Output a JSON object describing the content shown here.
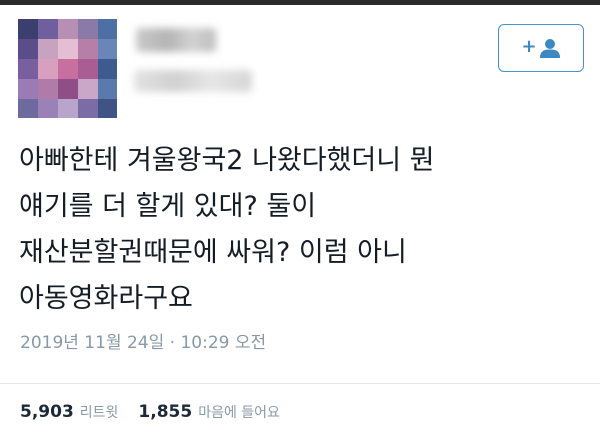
{
  "tweet": {
    "lines": [
      "아빠한테 겨울왕국2 나왔다했더니 뭔",
      "얘기를 더 할게 있대? 둘이",
      "재산분할권때문에 싸워? 이럼 아니",
      "아동영화라구요"
    ],
    "timestamp": "2019년 11월 24일 · 10:29 오전"
  },
  "follow_button": {
    "plus": "+",
    "icon": "person-icon",
    "color": "#3b88c3"
  },
  "stats": {
    "retweets_count": "5,903",
    "retweets_label": "리트윗",
    "likes_count": "1,855",
    "likes_label": "마음에 들어요"
  },
  "colors": {
    "text": "#141d26",
    "muted": "#8899a6",
    "accent": "#3b88c3"
  }
}
